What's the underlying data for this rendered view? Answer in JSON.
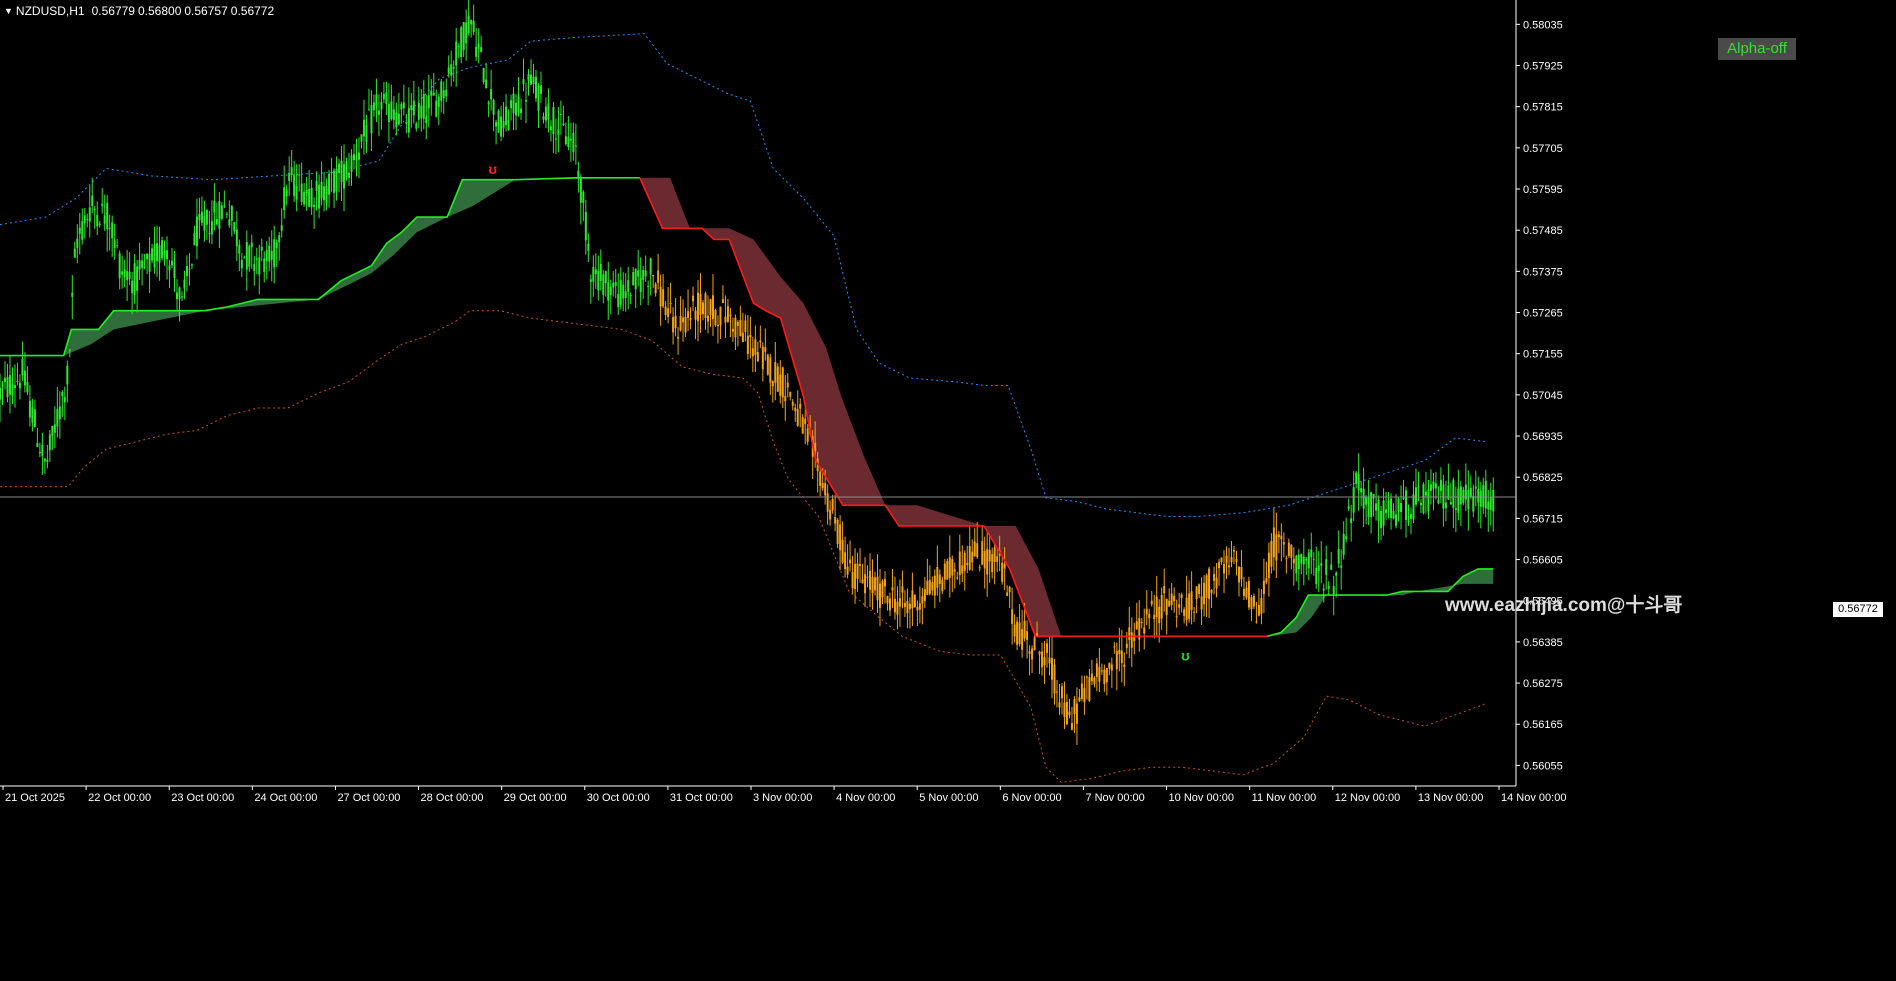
{
  "header": {
    "symbol_timeframe": "NZDUSD,H1",
    "open": "0.56779",
    "high": "0.56800",
    "low": "0.56757",
    "close": "0.56772",
    "menu_icon": "triangle-down-icon"
  },
  "alpha_button": {
    "label": "Alpha-off",
    "color": "#34e034"
  },
  "watermark": {
    "text": "www.eazhijia.com@十斗哥"
  },
  "current_price": {
    "value": 0.56772,
    "label": "0.56772"
  },
  "signals": [
    {
      "type": "sell",
      "glyph": "ʊ",
      "color": "#ff2020",
      "x": 32.5,
      "price": 0.57635
    },
    {
      "type": "buy",
      "glyph": "ʊ",
      "color": "#22dd22",
      "x": 78.2,
      "price": 0.56335
    }
  ],
  "colors": {
    "background": "#000000",
    "bull_candle": "#2ee82e",
    "bear_candle": "#f2a21c",
    "upper_band": "#1e90ff",
    "lower_band": "#c8561c",
    "trail_up": "#22ee22",
    "trail_up_fill": "#2f6e3a",
    "trail_down": "#ff1a1a",
    "trail_down_fill": "#6b2a30",
    "axis": "#ffffff",
    "price_line": "#8a8a8a"
  },
  "chart_data": {
    "type": "candlestick",
    "symbol": "NZDUSD",
    "timeframe": "H1",
    "ylim": [
      0.56,
      0.581
    ],
    "y_ticks": [
      "0.58035",
      "0.57925",
      "0.57815",
      "0.57705",
      "0.57595",
      "0.57485",
      "0.57375",
      "0.57265",
      "0.57155",
      "0.57045",
      "0.56935",
      "0.56825",
      "0.56715",
      "0.56605",
      "0.56495",
      "0.56385",
      "0.56275",
      "0.56165",
      "0.56055"
    ],
    "x_labels": [
      "21 Oct 2025",
      "22 Oct 00:00",
      "23 Oct 00:00",
      "24 Oct 00:00",
      "27 Oct 00:00",
      "28 Oct 00:00",
      "29 Oct 00:00",
      "30 Oct 00:00",
      "31 Oct 00:00",
      "3 Nov 00:00",
      "4 Nov 00:00",
      "5 Nov 00:00",
      "6 Nov 00:00",
      "7 Nov 00:00",
      "10 Nov 00:00",
      "11 Nov 00:00",
      "12 Nov 00:00",
      "13 Nov 00:00",
      "14 Nov 00:00"
    ],
    "price_path": [
      [
        0,
        0.5705
      ],
      [
        1.5,
        0.571
      ],
      [
        3,
        0.5685
      ],
      [
        4.5,
        0.571
      ],
      [
        5,
        0.5745
      ],
      [
        6,
        0.5755
      ],
      [
        7.2,
        0.5752
      ],
      [
        8,
        0.5738
      ],
      [
        9,
        0.5735
      ],
      [
        11,
        0.5745
      ],
      [
        12,
        0.5728
      ],
      [
        13,
        0.5748
      ],
      [
        15,
        0.5755
      ],
      [
        16,
        0.5742
      ],
      [
        18,
        0.574
      ],
      [
        19,
        0.5762
      ],
      [
        21,
        0.5758
      ],
      [
        23,
        0.5765
      ],
      [
        25,
        0.5782
      ],
      [
        27,
        0.5778
      ],
      [
        29,
        0.5784
      ],
      [
        31,
        0.5805
      ],
      [
        33,
        0.5775
      ],
      [
        35,
        0.5788
      ],
      [
        36.5,
        0.5778
      ],
      [
        38,
        0.577
      ],
      [
        39,
        0.5738
      ],
      [
        41,
        0.5731
      ],
      [
        43,
        0.5738
      ],
      [
        44.5,
        0.5722
      ],
      [
        46,
        0.5728
      ],
      [
        48,
        0.5726
      ],
      [
        50,
        0.5716
      ],
      [
        52,
        0.5706
      ],
      [
        54,
        0.5685
      ],
      [
        56,
        0.5658
      ],
      [
        58,
        0.5652
      ],
      [
        60,
        0.5648
      ],
      [
        62,
        0.5655
      ],
      [
        64,
        0.5662
      ],
      [
        66,
        0.566
      ],
      [
        67,
        0.5642
      ],
      [
        69,
        0.5635
      ],
      [
        70.5,
        0.5617
      ],
      [
        72,
        0.5628
      ],
      [
        74,
        0.5635
      ],
      [
        75,
        0.5642
      ],
      [
        77,
        0.565
      ],
      [
        78.5,
        0.5647
      ],
      [
        80,
        0.5655
      ],
      [
        81.5,
        0.566
      ],
      [
        83,
        0.5645
      ],
      [
        84,
        0.5665
      ],
      [
        86,
        0.566
      ],
      [
        88,
        0.5655
      ],
      [
        89.5,
        0.568
      ],
      [
        91,
        0.5672
      ],
      [
        93,
        0.5675
      ],
      [
        95,
        0.5678
      ],
      [
        97,
        0.5677
      ],
      [
        98,
        0.56772
      ]
    ],
    "bear_from_x": 43,
    "bull_from_x": 85.5,
    "upper_band": [
      [
        0,
        0.575
      ],
      [
        3,
        0.5752
      ],
      [
        5,
        0.5757
      ],
      [
        7,
        0.5765
      ],
      [
        10,
        0.5763
      ],
      [
        14,
        0.5762
      ],
      [
        18,
        0.5763
      ],
      [
        22,
        0.5764
      ],
      [
        25,
        0.5767
      ],
      [
        27,
        0.578
      ],
      [
        29,
        0.5789
      ],
      [
        31,
        0.5792
      ],
      [
        33.5,
        0.5794
      ],
      [
        35,
        0.5799
      ],
      [
        38,
        0.58
      ],
      [
        42.5,
        0.5801
      ],
      [
        44,
        0.5793
      ],
      [
        46,
        0.5789
      ],
      [
        48,
        0.5785
      ],
      [
        49.5,
        0.5783
      ],
      [
        51,
        0.5765
      ],
      [
        53,
        0.5757
      ],
      [
        55,
        0.5747
      ],
      [
        56.5,
        0.5722
      ],
      [
        58,
        0.5713
      ],
      [
        59,
        0.5711
      ],
      [
        60,
        0.5709
      ],
      [
        63,
        0.5708
      ],
      [
        65,
        0.5707
      ],
      [
        66.5,
        0.5707
      ],
      [
        68,
        0.569
      ],
      [
        69,
        0.5677
      ],
      [
        71,
        0.5676
      ],
      [
        73,
        0.5674
      ],
      [
        75,
        0.5673
      ],
      [
        77,
        0.5672
      ],
      [
        79,
        0.5672
      ],
      [
        82,
        0.5673
      ],
      [
        85,
        0.5675
      ],
      [
        88,
        0.5679
      ],
      [
        91,
        0.5683
      ],
      [
        94,
        0.5687
      ],
      [
        96,
        0.5693
      ],
      [
        98,
        0.5692
      ]
    ],
    "lower_band": [
      [
        0,
        0.568
      ],
      [
        3,
        0.568
      ],
      [
        4.5,
        0.568
      ],
      [
        5.5,
        0.5685
      ],
      [
        7,
        0.569
      ],
      [
        9,
        0.5692
      ],
      [
        11,
        0.5694
      ],
      [
        13,
        0.5695
      ],
      [
        15,
        0.5699
      ],
      [
        17,
        0.5701
      ],
      [
        19,
        0.5701
      ],
      [
        21,
        0.5705
      ],
      [
        23,
        0.5708
      ],
      [
        25,
        0.5714
      ],
      [
        26.5,
        0.5718
      ],
      [
        28,
        0.572
      ],
      [
        30,
        0.5724
      ],
      [
        31,
        0.5727
      ],
      [
        33,
        0.5727
      ],
      [
        35,
        0.5725
      ],
      [
        37,
        0.5724
      ],
      [
        39,
        0.5723
      ],
      [
        41,
        0.5722
      ],
      [
        43,
        0.5719
      ],
      [
        45,
        0.5712
      ],
      [
        47,
        0.571
      ],
      [
        49,
        0.5709
      ],
      [
        50,
        0.5705
      ],
      [
        51,
        0.5692
      ],
      [
        52,
        0.5682
      ],
      [
        54,
        0.5672
      ],
      [
        56,
        0.5652
      ],
      [
        58,
        0.5645
      ],
      [
        59.5,
        0.564
      ],
      [
        62,
        0.5636
      ],
      [
        64,
        0.5635
      ],
      [
        66,
        0.5635
      ],
      [
        68,
        0.5621
      ],
      [
        69,
        0.5605
      ],
      [
        70,
        0.5601
      ],
      [
        72,
        0.5602
      ],
      [
        74,
        0.5604
      ],
      [
        76,
        0.5605
      ],
      [
        78,
        0.5605
      ],
      [
        80,
        0.5604
      ],
      [
        82,
        0.5603
      ],
      [
        84,
        0.5606
      ],
      [
        86,
        0.5613
      ],
      [
        87.5,
        0.5624
      ],
      [
        89,
        0.5623
      ],
      [
        91,
        0.5619
      ],
      [
        93,
        0.5617
      ],
      [
        94,
        0.5616
      ],
      [
        96,
        0.5619
      ],
      [
        98,
        0.5622
      ]
    ],
    "trail_up_1": [
      [
        0,
        0.5715
      ],
      [
        4.2,
        0.5715
      ],
      [
        4.7,
        0.5722
      ],
      [
        6.5,
        0.5722
      ],
      [
        7.5,
        0.5727
      ],
      [
        13.5,
        0.5727
      ],
      [
        15,
        0.5728
      ],
      [
        17,
        0.573
      ],
      [
        21,
        0.573
      ],
      [
        22.5,
        0.5735
      ],
      [
        23.5,
        0.5737
      ],
      [
        24.5,
        0.5739
      ],
      [
        25.5,
        0.5745
      ],
      [
        26.5,
        0.5748
      ],
      [
        27.5,
        0.5752
      ],
      [
        29.5,
        0.5752
      ],
      [
        30.5,
        0.5762
      ],
      [
        34,
        0.5762
      ],
      [
        38,
        0.57625
      ],
      [
        42.2,
        0.57625
      ]
    ],
    "trail_up_1_step": [
      [
        0,
        0.5715
      ],
      [
        4.2,
        0.5715
      ],
      [
        6,
        0.5718
      ],
      [
        7.5,
        0.5722
      ],
      [
        13.5,
        0.5727
      ],
      [
        16,
        0.5728
      ],
      [
        21,
        0.573
      ],
      [
        22.5,
        0.5733
      ],
      [
        24.5,
        0.5737
      ],
      [
        26,
        0.5742
      ],
      [
        27.5,
        0.5748
      ],
      [
        29.5,
        0.5752
      ],
      [
        31.2,
        0.5755
      ],
      [
        34,
        0.5762
      ],
      [
        42.2,
        0.57625
      ]
    ],
    "trail_down": [
      [
        42.2,
        0.57625
      ],
      [
        43.7,
        0.5749
      ],
      [
        46.3,
        0.5749
      ],
      [
        47.1,
        0.5746
      ],
      [
        48.1,
        0.5746
      ],
      [
        49.7,
        0.5729
      ],
      [
        50.5,
        0.5727
      ],
      [
        51.5,
        0.5725
      ],
      [
        53,
        0.5704
      ],
      [
        53.8,
        0.5687
      ],
      [
        55.6,
        0.5675
      ],
      [
        58.4,
        0.5675
      ],
      [
        59.3,
        0.56695
      ],
      [
        64.9,
        0.56695
      ],
      [
        66.6,
        0.5658
      ],
      [
        68.3,
        0.564
      ],
      [
        83.6,
        0.564
      ]
    ],
    "trail_down_step": [
      [
        42.2,
        0.57625
      ],
      [
        44.2,
        0.57625
      ],
      [
        45.5,
        0.5749
      ],
      [
        48.1,
        0.5749
      ],
      [
        49.7,
        0.5746
      ],
      [
        51.5,
        0.5736
      ],
      [
        53,
        0.5729
      ],
      [
        54.5,
        0.5717
      ],
      [
        55.5,
        0.5704
      ],
      [
        57,
        0.5688
      ],
      [
        58.4,
        0.5675
      ],
      [
        60.5,
        0.5675
      ],
      [
        64.9,
        0.56695
      ],
      [
        67,
        0.56695
      ],
      [
        68.5,
        0.5658
      ],
      [
        70,
        0.564
      ],
      [
        83.6,
        0.564
      ]
    ],
    "trail_up_2": [
      [
        83.6,
        0.564
      ],
      [
        84.5,
        0.5641
      ],
      [
        85.5,
        0.5645
      ],
      [
        86.3,
        0.5651
      ],
      [
        91.5,
        0.5651
      ],
      [
        92.5,
        0.5652
      ],
      [
        95.5,
        0.5652
      ],
      [
        96.5,
        0.5656
      ],
      [
        97.5,
        0.5658
      ],
      [
        98.5,
        0.5658
      ]
    ],
    "trail_up_2_step": [
      [
        83.6,
        0.564
      ],
      [
        85.5,
        0.5641
      ],
      [
        86.5,
        0.5645
      ],
      [
        87.5,
        0.5651
      ],
      [
        92.5,
        0.5651
      ],
      [
        93.5,
        0.5652
      ],
      [
        96.5,
        0.5654
      ],
      [
        98.5,
        0.5654
      ]
    ]
  }
}
